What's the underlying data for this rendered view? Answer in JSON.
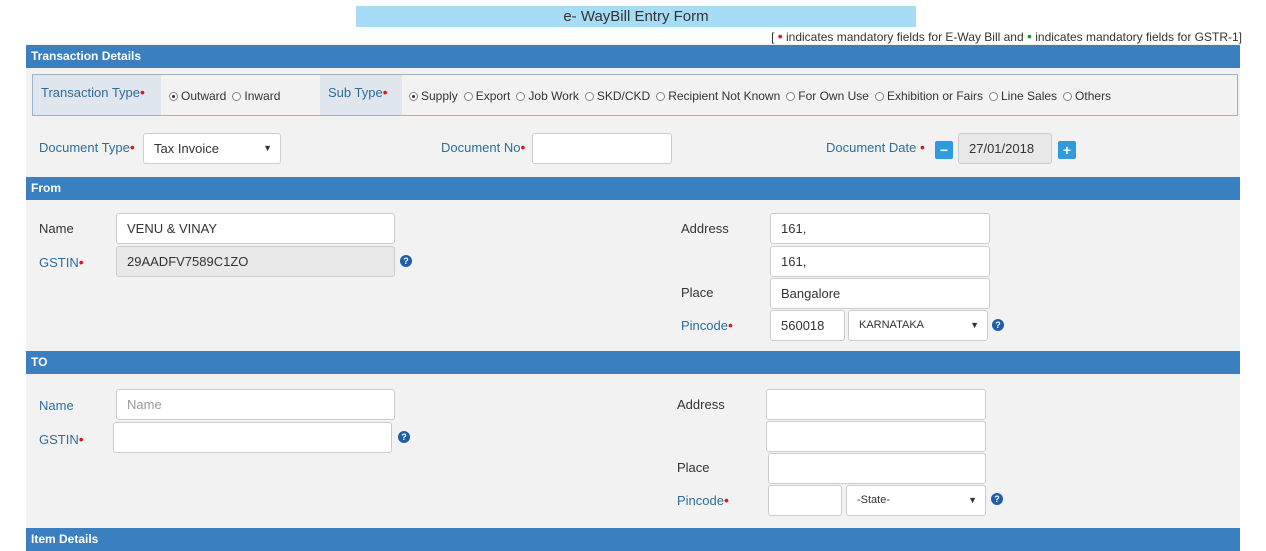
{
  "title": "e- WayBill Entry Form",
  "legend": {
    "open": "[",
    "red_text": "indicates mandatory fields for E-Way Bill and",
    "green_text": "indicates mandatory fields for GSTR-1]",
    "dot": "•"
  },
  "sections": {
    "transaction": "Transaction Details",
    "from": "From",
    "to": "TO",
    "items": "Item Details"
  },
  "transaction": {
    "type_label": "Transaction Type",
    "type_options": [
      "Outward",
      "Inward"
    ],
    "type_selected": "Outward",
    "subtype_label": "Sub Type",
    "subtype_options": [
      "Supply",
      "Export",
      "Job Work",
      "SKD/CKD",
      "Recipient Not Known",
      "For Own Use",
      "Exhibition or Fairs",
      "Line Sales",
      "Others"
    ],
    "subtype_selected": "Supply"
  },
  "document": {
    "type_label": "Document Type",
    "type_value": "Tax Invoice",
    "no_label": "Document No",
    "no_value": "",
    "date_label": "Document Date",
    "date_value": "27/01/2018"
  },
  "from": {
    "name_label": "Name",
    "name_value": "VENU & VINAY",
    "gstin_label": "GSTIN",
    "gstin_value": "29AADFV7589C1ZO",
    "address_label": "Address",
    "address1": "161,",
    "address2": "161,",
    "place_label": "Place",
    "place_value": "Bangalore",
    "pincode_label": "Pincode",
    "pincode_value": "560018",
    "state_value": "KARNATAKA"
  },
  "to": {
    "name_label": "Name",
    "name_placeholder": "Name",
    "gstin_label": "GSTIN",
    "address_label": "Address",
    "place_label": "Place",
    "pincode_label": "Pincode",
    "state_value": "-State-"
  },
  "icons": {
    "help": "?",
    "caret": "▼",
    "minus": "−",
    "plus": "+",
    "mandatory_red": "#e0141e",
    "mandatory_green": "#1a9c35"
  },
  "colors": {
    "section_bar": "#3a7fbf",
    "title_bg": "#a6dcf5",
    "label_blue": "#2d6e9e"
  }
}
